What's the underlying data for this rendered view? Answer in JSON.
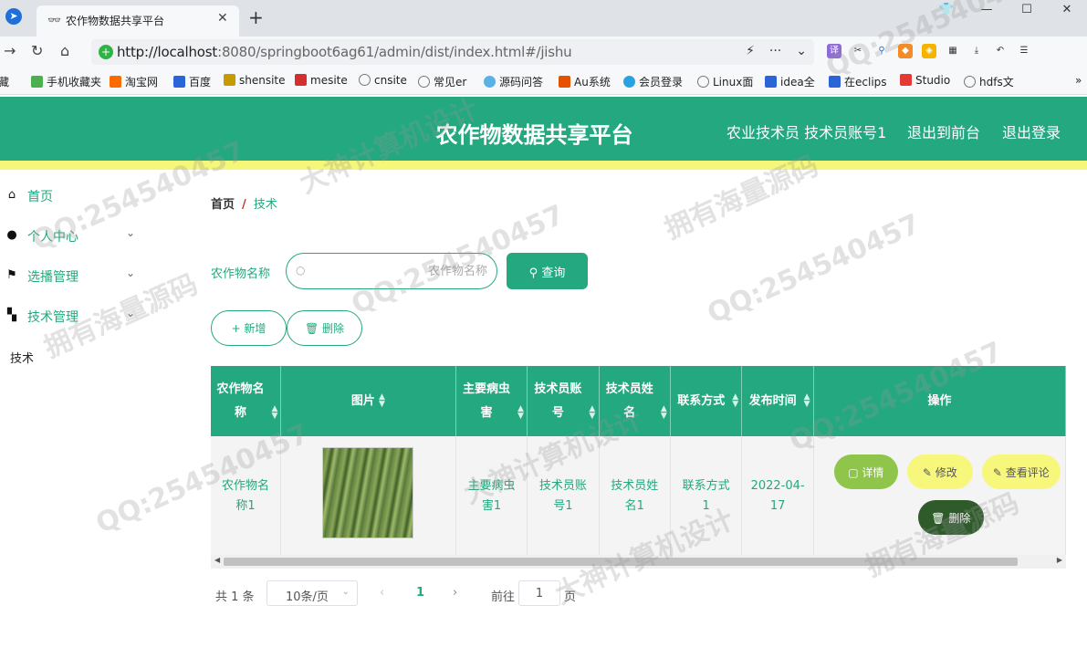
{
  "browser": {
    "tab_title": "农作物数据共享平台",
    "url_host": "http://localhost",
    "url_rest": ":8080/springboot6ag61/admin/dist/index.html#/jishu",
    "bookmarks": [
      "藏",
      "手机收藏夹",
      "淘宝网",
      "百度",
      "shensite",
      "mesite",
      "cnsite",
      "常见er",
      "源码问答",
      "Au系统",
      "会员登录",
      "Linux面",
      "idea全",
      "在eclips",
      "Studio",
      "hdfs文"
    ]
  },
  "header": {
    "title": "农作物数据共享平台",
    "user": "农业技术员 技术员账号1",
    "to_front": "退出到前台",
    "logout": "退出登录"
  },
  "sidebar": {
    "items": [
      {
        "label": "首页",
        "icon": "home-icon"
      },
      {
        "label": "个人中心",
        "icon": "user-icon"
      },
      {
        "label": "选播管理",
        "icon": "flag-icon"
      },
      {
        "label": "技术管理",
        "icon": "grid-icon"
      }
    ],
    "sub_item": "技术"
  },
  "breadcrumb": {
    "home": "首页",
    "sep": "/",
    "current": "技术"
  },
  "search": {
    "label": "农作物名称",
    "placeholder": "农作物名称",
    "button": "查询"
  },
  "actions": {
    "add": "+ 新增",
    "delete": "删除"
  },
  "table": {
    "columns": [
      {
        "label": "农作物名称",
        "width": 78
      },
      {
        "label": "图片",
        "width": 200
      },
      {
        "label": "主要病虫害",
        "width": 80
      },
      {
        "label": "技术员账号",
        "width": 80
      },
      {
        "label": "技术员姓名",
        "width": 80
      },
      {
        "label": "联系方式",
        "width": 80
      },
      {
        "label": "发布时间",
        "width": 80
      },
      {
        "label": "操作",
        "width": 300
      }
    ],
    "rows": [
      {
        "name": "农作物名称1",
        "disease": "主要病虫害1",
        "account": "技术员账号1",
        "tech_name": "技术员姓名1",
        "contact": "联系方式1",
        "date": "2022-04-17"
      }
    ],
    "ops": {
      "detail": "详情",
      "edit": "修改",
      "comment": "查看评论",
      "delete": "删除"
    }
  },
  "pager": {
    "total": "共 1 条",
    "page_size": "10条/页",
    "current": "1",
    "goto_label": "前往",
    "goto_value": "1",
    "unit": "页"
  },
  "watermarks": [
    "QQ:254540457",
    "大神计算机设计",
    "拥有海量源码"
  ],
  "colors": {
    "primary": "#23a87f",
    "stripe": "#f5f77a"
  }
}
